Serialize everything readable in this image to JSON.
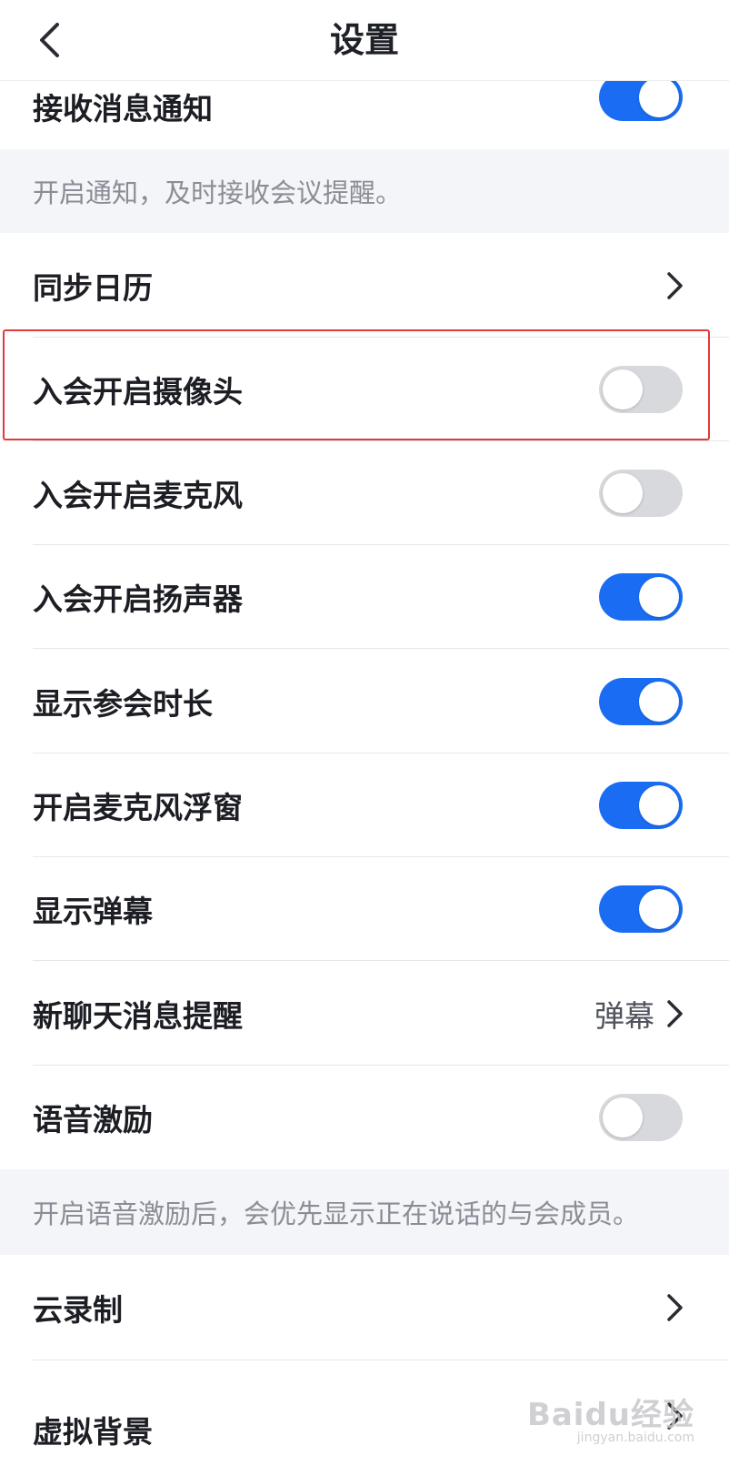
{
  "header": {
    "title": "设置",
    "back_icon": "chevron-left-icon"
  },
  "colors": {
    "accent": "#1a6df3",
    "toggle_off": "#d8d9dd",
    "highlight": "#e03a3a"
  },
  "settings": {
    "receive_notifications": {
      "label": "接收消息通知",
      "enabled": true
    },
    "notification_hint": "开启通知，及时接收会议提醒。",
    "sync_calendar": {
      "label": "同步日历"
    },
    "join_camera": {
      "label": "入会开启摄像头",
      "enabled": false
    },
    "join_microphone": {
      "label": "入会开启麦克风",
      "enabled": false
    },
    "join_speaker": {
      "label": "入会开启扬声器",
      "enabled": true
    },
    "show_duration": {
      "label": "显示参会时长",
      "enabled": true
    },
    "mic_floating_window": {
      "label": "开启麦克风浮窗",
      "enabled": true
    },
    "show_danmaku": {
      "label": "显示弹幕",
      "enabled": true
    },
    "new_chat_reminder": {
      "label": "新聊天消息提醒",
      "value": "弹幕"
    },
    "voice_excitation": {
      "label": "语音激励",
      "enabled": false
    },
    "voice_excitation_hint": "开启语音激励后，会优先显示正在说话的与会成员。",
    "cloud_recording": {
      "label": "云录制"
    },
    "virtual_background": {
      "label": "虚拟背景"
    }
  },
  "watermark": {
    "main": "Baidu经验",
    "sub": "jingyan.baidu.com"
  }
}
